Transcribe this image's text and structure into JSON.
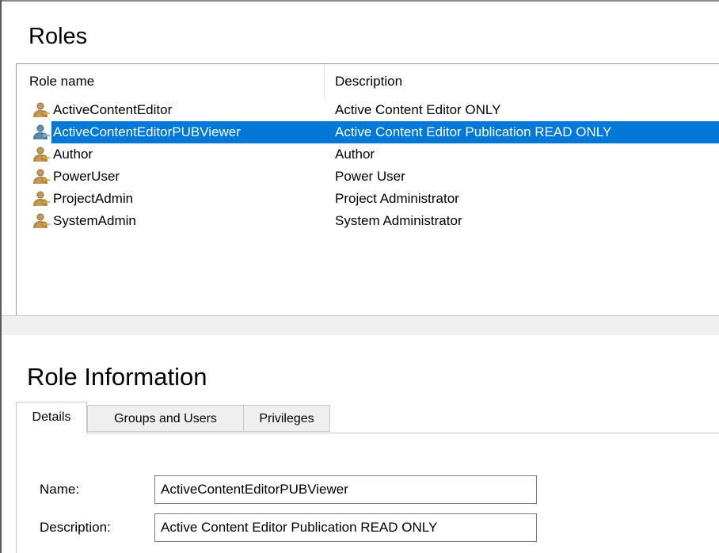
{
  "roles_panel": {
    "title": "Roles",
    "columns": {
      "name": "Role name",
      "description": "Description"
    },
    "rows": [
      {
        "name": "ActiveContentEditor",
        "description": "Active Content Editor ONLY",
        "icon": "role-users-icon",
        "selected": false
      },
      {
        "name": "ActiveContentEditorPUBViewer",
        "description": "Active Content Editor Publication READ ONLY",
        "icon": "role-users-icon",
        "selected": true
      },
      {
        "name": "Author",
        "description": "Author",
        "icon": "role-users-icon",
        "selected": false
      },
      {
        "name": "PowerUser",
        "description": "Power User",
        "icon": "role-users-icon",
        "selected": false
      },
      {
        "name": "ProjectAdmin",
        "description": "Project Administrator",
        "icon": "role-users-icon",
        "selected": false
      },
      {
        "name": "SystemAdmin",
        "description": "System Administrator",
        "icon": "role-users-icon",
        "selected": false
      }
    ]
  },
  "info_panel": {
    "title": "Role Information",
    "tabs": [
      {
        "label": "Details",
        "active": true
      },
      {
        "label": "Groups and Users",
        "active": false
      },
      {
        "label": "Privileges",
        "active": false
      }
    ],
    "fields": {
      "name_label": "Name:",
      "name_value": "ActiveContentEditorPUBViewer",
      "description_label": "Description:",
      "description_value": "Active Content Editor Publication READ ONLY"
    }
  },
  "colors": {
    "selection": "#0078d7",
    "icon_person_tan": "#c49a5a",
    "icon_person_selected": "#5f8fae",
    "icon_key": "#d8a431"
  }
}
